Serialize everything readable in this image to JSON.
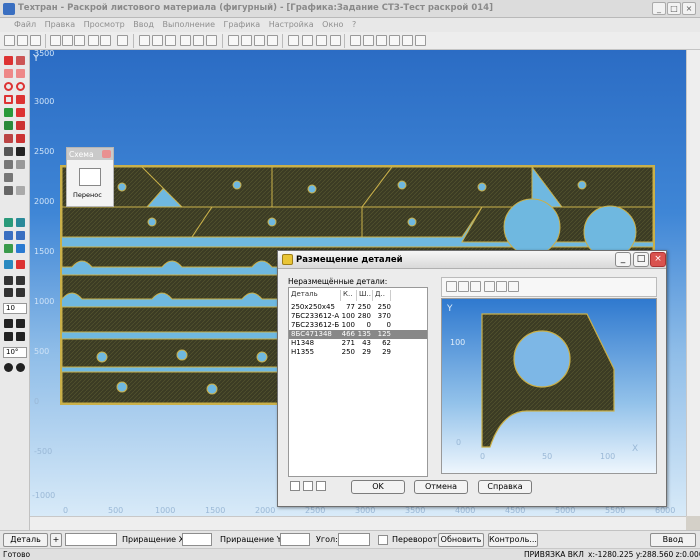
{
  "window": {
    "title": "Техтран - Раскрой листового материала (фигурный) - [Графика:Задание СТЗ-Тест раскрой 014]"
  },
  "menu": [
    "Файл",
    "Правка",
    "Просмотр",
    "Ввод",
    "Выполнение",
    "Графика",
    "Настройка",
    "Окно",
    "?"
  ],
  "canvas": {
    "y_axis_letter": "Y",
    "x_axis_letter": "X",
    "y_ticks": [
      "3500",
      "3000",
      "2500",
      "2000",
      "1500",
      "1000",
      "500",
      "0",
      "-500",
      "-1000"
    ],
    "x_ticks": [
      "0",
      "500",
      "1000",
      "1500",
      "2000",
      "2500",
      "3000",
      "3500",
      "4000",
      "4500",
      "5000",
      "5500",
      "6000"
    ]
  },
  "left_tools": {
    "step_value": "10",
    "angle_value": "10°"
  },
  "schema_palette": {
    "title": "Схема",
    "button_label": "Перенос"
  },
  "dialog": {
    "title": "Размещение деталей",
    "list_label": "Неразмещённые детали:",
    "columns": [
      "Деталь",
      "К..",
      "Ш..",
      "Д.."
    ],
    "rows": [
      {
        "name": "250x250x45",
        "k": "77",
        "w": "250",
        "l": "250"
      },
      {
        "name": "7БС233612-А",
        "k": "100",
        "w": "280",
        "l": "370"
      },
      {
        "name": "7БС233612-Б",
        "k": "100",
        "w": "0",
        "l": "0"
      },
      {
        "name": "8БС471348",
        "k": "466",
        "w": "135",
        "l": "125"
      },
      {
        "name": "Н1348",
        "k": "271",
        "w": "43",
        "l": "62"
      },
      {
        "name": "Н1355",
        "k": "250",
        "w": "29",
        "l": "29"
      }
    ],
    "selected_index": 3,
    "preview": {
      "y_letter": "Y",
      "x_letter": "X",
      "y_ticks": [
        "100",
        "0"
      ],
      "x_ticks": [
        "0",
        "50",
        "100"
      ]
    },
    "buttons": {
      "ok": "OK",
      "cancel": "Отмена",
      "help": "Справка"
    }
  },
  "bottom_bar": {
    "detail_label": "Деталь",
    "increment_x_label": "Приращение X:",
    "increment_y_label": "Приращение Y:",
    "angle_label": "Угол:",
    "flip_label": "Переворот",
    "update_label": "Обновить",
    "control_label": "Контроль...",
    "enter_label": "Ввод"
  },
  "status": {
    "ready": "Готово",
    "snap": "ПРИВЯЗКА ВКЛ",
    "coords": "x:-1280.225 y:288.560 z:0.000"
  },
  "colors": {
    "canvas_top": "#2b6cc4",
    "sheet_fill": "#3a3a24",
    "part_outline": "#c9b04a",
    "selected_row": "#888888"
  }
}
